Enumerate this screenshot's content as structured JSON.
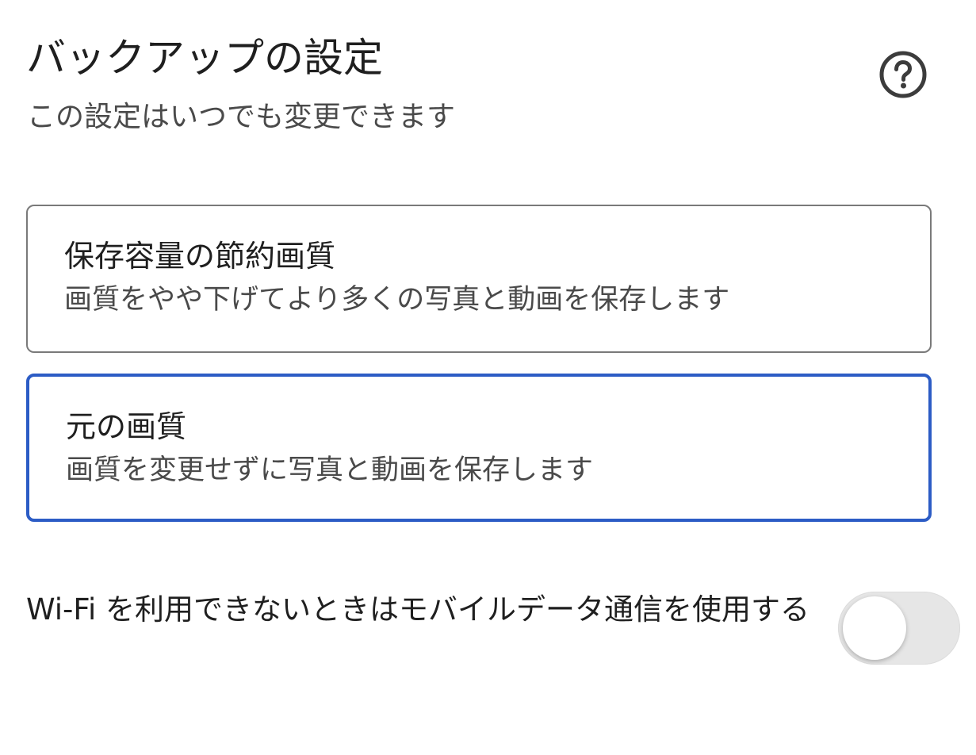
{
  "header": {
    "title": "バックアップの設定",
    "subtitle": "この設定はいつでも変更できます",
    "help_icon": "help-circle-icon"
  },
  "options": [
    {
      "title": "保存容量の節約画質",
      "description": "画質をやや下げてより多くの写真と動画を保存します",
      "selected": false
    },
    {
      "title": "元の画質",
      "description": "画質を変更せずに写真と動画を保存します",
      "selected": true
    }
  ],
  "mobile_data": {
    "label": "Wi-Fi を利用できないときはモバイルデータ通信を使用する",
    "enabled": false
  },
  "colors": {
    "selected_border": "#2c5cc5",
    "unselected_border": "#7a7a7a",
    "toggle_off_track": "#e6e6e6"
  }
}
